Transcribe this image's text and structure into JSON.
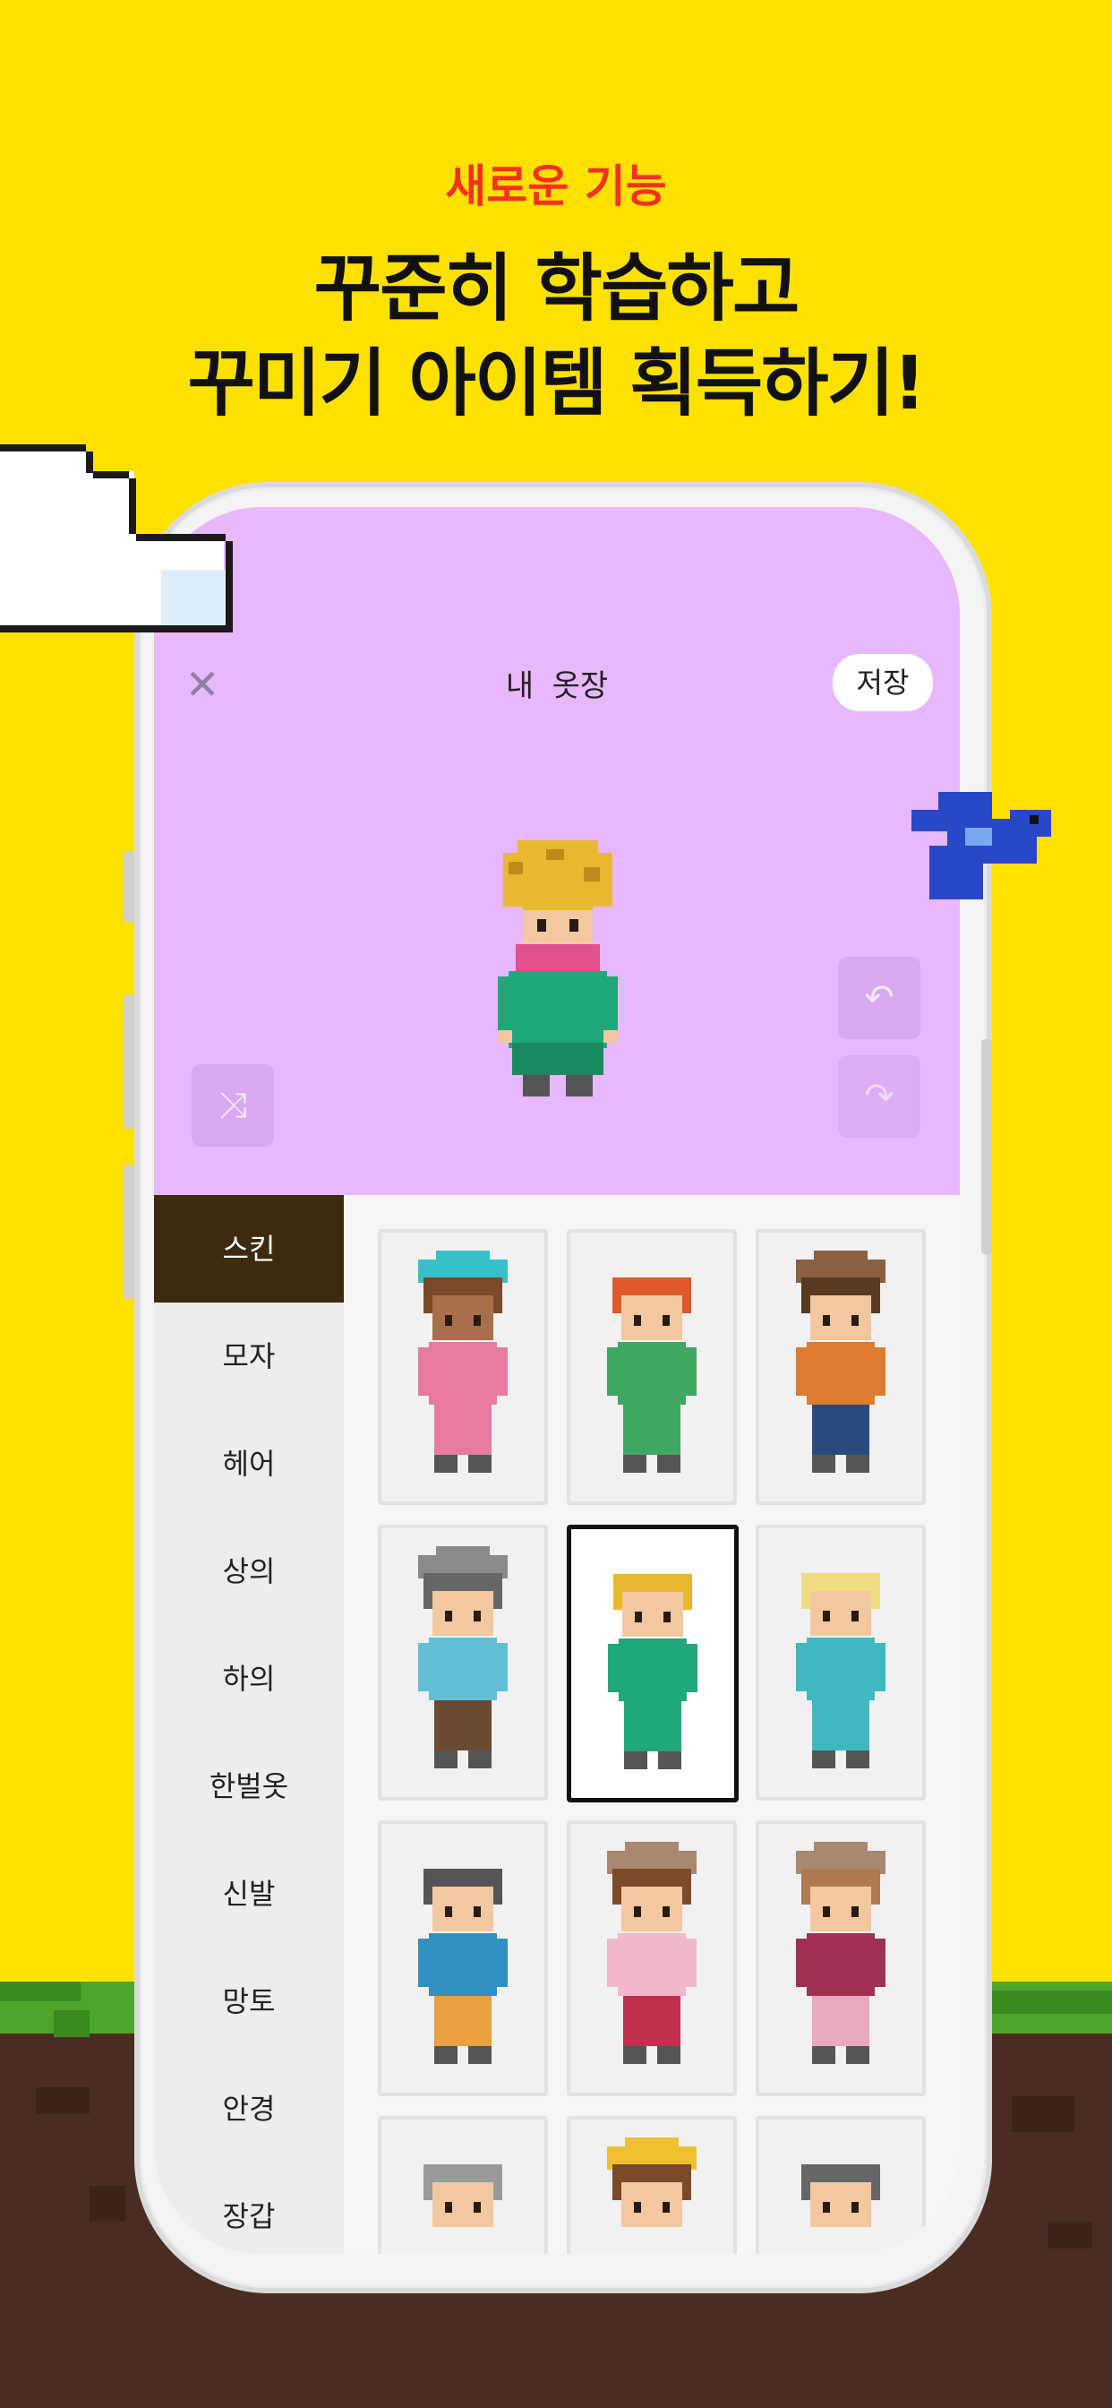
{
  "promo": {
    "label": "새로운 기능",
    "headline_line1": "꾸준히 학습하고",
    "headline_line2": "꾸미기 아이템 획득하기!"
  },
  "closet": {
    "title": "내 옷장",
    "save_label": "저장",
    "icons": {
      "close": "close-icon",
      "shuffle": "shuffle-icon",
      "undo": "undo-icon",
      "redo": "redo-icon"
    }
  },
  "categories": [
    {
      "label": "스킨",
      "active": true
    },
    {
      "label": "모자",
      "active": false
    },
    {
      "label": "헤어",
      "active": false
    },
    {
      "label": "상의",
      "active": false
    },
    {
      "label": "하의",
      "active": false
    },
    {
      "label": "한벌옷",
      "active": false
    },
    {
      "label": "신발",
      "active": false
    },
    {
      "label": "망토",
      "active": false
    },
    {
      "label": "안경",
      "active": false
    },
    {
      "label": "장갑",
      "active": false
    }
  ],
  "skins": [
    {
      "name": "teal-witch-hat-pink-dress",
      "hat": "#38C0C8",
      "hair": "#7A4A2A",
      "top": "#E87AA0",
      "bottom": "#E87AA0",
      "skin": "#A8704A"
    },
    {
      "name": "red-hair-green-overalls",
      "hat": null,
      "hair": "#E0582A",
      "top": "#3FA860",
      "bottom": "#3FA860",
      "skin": "#F2C8A0"
    },
    {
      "name": "cowboy-hat-orange-vest",
      "hat": "#8A6040",
      "hair": "#5A3A20",
      "top": "#E07A30",
      "bottom": "#2A4A80",
      "skin": "#F2C8A0"
    },
    {
      "name": "gray-hat-teal-shirt",
      "hat": "#8A8A8A",
      "hair": "#666666",
      "top": "#60C0D8",
      "bottom": "#6A4A30",
      "skin": "#F2C8A0"
    },
    {
      "name": "curly-blond-pink-scarf",
      "hat": null,
      "hair": "#E8B830",
      "top": "#20A878",
      "bottom": "#20A878",
      "skin": "#F2C8A0",
      "selected": true
    },
    {
      "name": "long-blond-teal-dress",
      "hat": null,
      "hair": "#F0DC80",
      "top": "#40B8C0",
      "bottom": "#40B8C0",
      "skin": "#F2C8A0"
    },
    {
      "name": "spiky-gray-blue-shirt",
      "hat": null,
      "hair": "#555555",
      "top": "#3090C0",
      "bottom": "#E8A040",
      "skin": "#F2C8A0"
    },
    {
      "name": "mushroom-hat-pink-top",
      "hat": "#A88870",
      "hair": "#7A4A2A",
      "top": "#F0B8C8",
      "bottom": "#C03050",
      "skin": "#F2C8A0"
    },
    {
      "name": "mushroom-hat-long-hair",
      "hat": "#A88870",
      "hair": "#B07A50",
      "top": "#A03050",
      "bottom": "#E8A8C0",
      "skin": "#F2C8A0"
    },
    {
      "name": "gray-bob-partial",
      "hat": null,
      "hair": "#9A9A9A",
      "top": "#F1F1F1",
      "bottom": "#F1F1F1",
      "skin": "#F2C8A0"
    },
    {
      "name": "straw-hat-partial",
      "hat": "#F0C030",
      "hair": "#7A4A2A",
      "top": "#F1F1F1",
      "bottom": "#F1F1F1",
      "skin": "#F2C8A0"
    },
    {
      "name": "goggles-partial",
      "hat": null,
      "hair": "#666666",
      "top": "#F1F1F1",
      "bottom": "#F1F1F1",
      "skin": "#F2C8A0"
    }
  ],
  "colors": {
    "background": "#FFE100",
    "accent_red": "#F0321E",
    "stage_purple": "#E8B8FF",
    "active_category": "#3E2A0E"
  }
}
